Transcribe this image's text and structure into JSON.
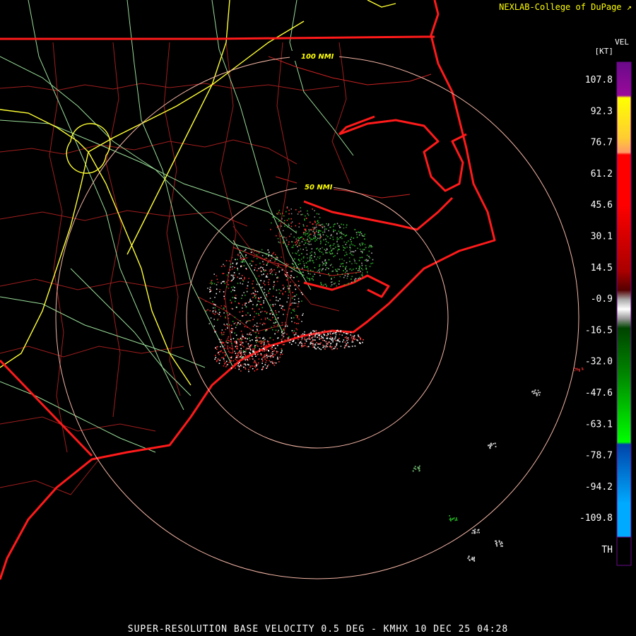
{
  "header": {
    "credit": "NEXLAB-College of DuPage"
  },
  "footer": {
    "product": "SUPER-RESOLUTION BASE VELOCITY 0.5 DEG - KMHX 10 DEC 25 04:28"
  },
  "range_rings": [
    {
      "label": "100 NMI"
    },
    {
      "label": "50 NMI"
    }
  ],
  "legend": {
    "title": "VEL",
    "unit": "[KT]",
    "ticks": [
      "107.8",
      "92.3",
      "76.7",
      "61.2",
      "45.6",
      "30.1",
      "14.5",
      "-0.9",
      "-16.5",
      "-32.0",
      "-47.6",
      "-63.1",
      "-78.7",
      "-94.2",
      "-109.8"
    ],
    "th_label": "TH"
  },
  "colors": {
    "coastline": "#ff1a1a",
    "state_border": "#ff1a1a",
    "county_lines": "#b22222",
    "highways_major": "#ffff33",
    "highways_minor": "#99dd99",
    "range_ring": "#f4b6a6"
  }
}
